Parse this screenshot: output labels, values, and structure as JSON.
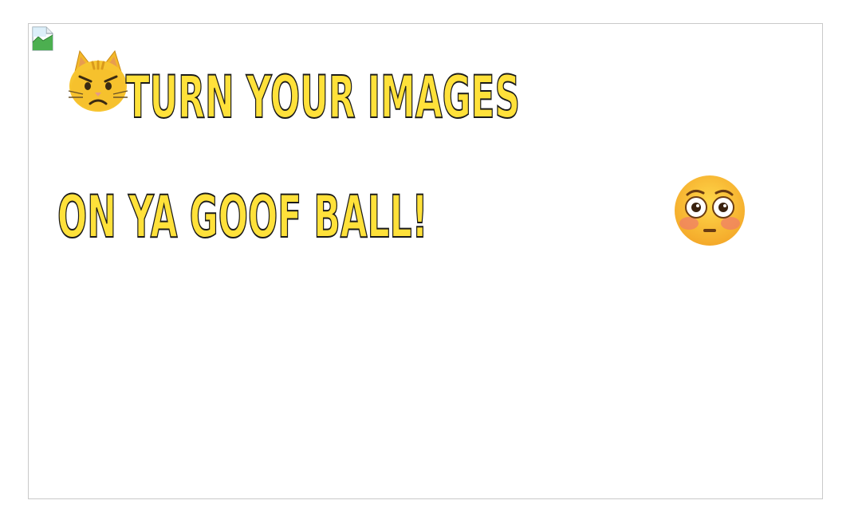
{
  "image": {
    "placeholder_icon": "broken-image-icon"
  },
  "headline": {
    "line1": "TURN YOUR IMAGES",
    "line2": "ON YA GOOF BALL!",
    "leading_emoji": "angry-cat-emoji",
    "trailing_emoji": "flushed-face-emoji"
  },
  "colors": {
    "text_fill": "#ffe13a",
    "text_stroke": "#1a1a1a",
    "frame_border": "#c9c9c9"
  }
}
